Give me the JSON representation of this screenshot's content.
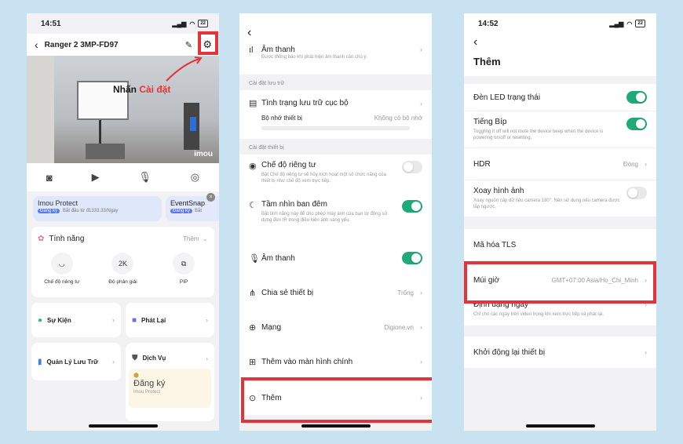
{
  "p1": {
    "time": "14:51",
    "battery": "22",
    "device_title": "Ranger 2 3MP-FD97",
    "annotation_prefix": "Nhấn",
    "annotation_highlight": "Cài đặt",
    "watermark": "imou",
    "promo1": {
      "title": "Imou Protect",
      "badge": "Đăng ký",
      "sub": "Bắt đầu từ đ1333.33/Ngày"
    },
    "promo2": {
      "title": "EventSnap",
      "badge": "Đăng ký",
      "sub": "Bắt"
    },
    "features_label": "Tính năng",
    "more_label": "Thêm",
    "features": [
      {
        "icon": "eye-closed-icon",
        "glyph": "◡",
        "label": "Chế độ riêng tư"
      },
      {
        "icon": "resolution-icon",
        "glyph": "2K",
        "label": "Độ phân giải"
      },
      {
        "icon": "pip-icon",
        "glyph": "⧉",
        "label": "PIP"
      }
    ],
    "events_label": "Sự Kiện",
    "playback_label": "Phát Lại",
    "storage_label": "Quản Lý Lưu Trữ",
    "service_label": "Dịch Vụ",
    "register_label": "Đăng ký",
    "protect_sub": "Imou Protect"
  },
  "p2": {
    "sound_top_label": "Âm thanh",
    "sound_top_desc": "Được thông báo khi phát hiện âm thanh cần chú ý.",
    "storage_section": "Cài đặt lưu trữ",
    "storage_status_label": "Tình trạng lưu trữ cục bộ",
    "device_storage_label": "Bộ nhớ thiết bị",
    "device_storage_value": "Không có bộ nhớ",
    "device_section": "Cài đặt thiết bị",
    "privacy_label": "Chế độ riêng tư",
    "privacy_desc": "Bật Chế độ riêng tư sẽ hủy kích hoạt một số chức năng của thiết bị như chế độ xem trực tiếp.",
    "night_label": "Tầm nhìn ban đêm",
    "night_desc": "Bật tính năng này để cho phép máy ảnh của bạn tự động sử dụng đèn IR trong điều kiện ánh sáng yếu.",
    "sound_label": "Âm thanh",
    "share_label": "Chia sẻ thiết bị",
    "share_value": "Trống",
    "network_label": "Mạng",
    "network_value": "Digione.vn",
    "homescreen_label": "Thêm vào màn hình chính",
    "more_label": "Thêm"
  },
  "p3": {
    "time": "14:52",
    "battery": "22",
    "page_title": "Thêm",
    "led_label": "Đèn LED trạng thái",
    "beep_label": "Tiếng Bíp",
    "beep_desc": "Toggling it off will not mute the device beep when the device is powering on/off or resetting.",
    "hdr_label": "HDR",
    "hdr_value": "Đóng",
    "flip_label": "Xoay hình ảnh",
    "flip_desc": "Xoay nguồn cấp dữ liệu camera 180°. Nên sử dụng nếu camera được lắp ngược.",
    "tls_label": "Mã hóa TLS",
    "timezone_label": "Múi giờ",
    "timezone_value": "GMT+07:00 Asia/Ho_Chi_Minh",
    "dateformat_label": "Định dạng ngày",
    "dateformat_desc": "Chỉ cho các ngày trên video trong khi xem trực tiếp và phát lại.",
    "reboot_label": "Khởi động lại thiết bị"
  },
  "colors": {
    "accent_red": "#e1353b",
    "toggle_green": "#1fab78"
  }
}
